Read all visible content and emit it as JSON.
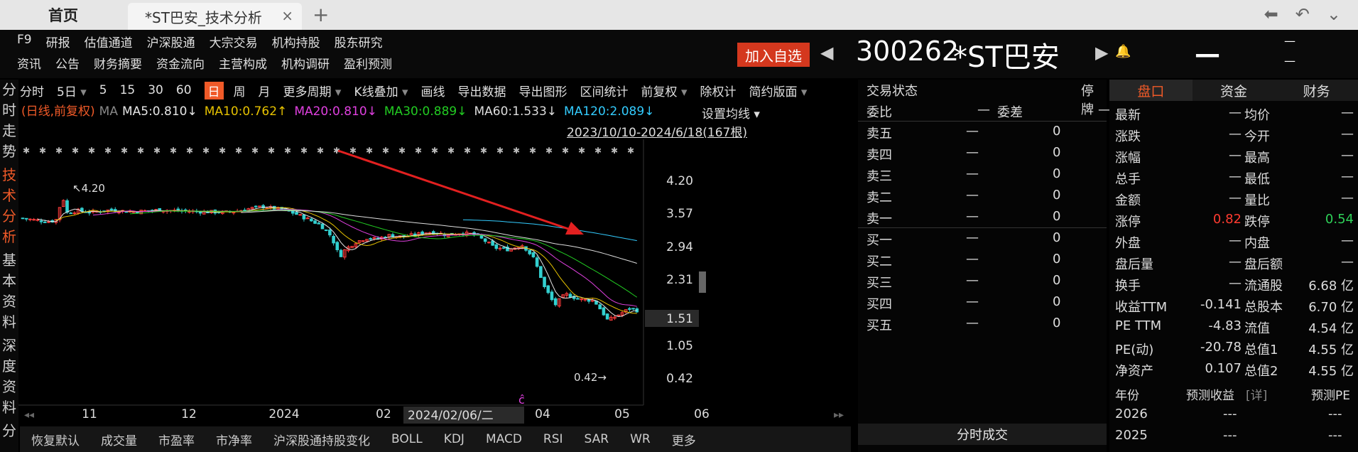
{
  "tabs": {
    "home": "首页",
    "active": "*ST巴安_技术分析",
    "close": "×",
    "add": "+"
  },
  "menu": {
    "row1": [
      "F9",
      "研报",
      "估值通道",
      "沪深股通",
      "大宗交易",
      "机构持股",
      "股东研究"
    ],
    "row2": [
      "资讯",
      "公告",
      "财务摘要",
      "资金流向",
      "主营构成",
      "机构调研",
      "盈利预测"
    ],
    "add_fav": "加入自选"
  },
  "stock": {
    "code": "300262",
    "name": "*ST巴安",
    "dash": "—"
  },
  "vnav": [
    {
      "label": "分时走势",
      "active": false
    },
    {
      "label": "技术分析",
      "active": true
    },
    {
      "label": "基本资料",
      "active": false
    },
    {
      "label": "深度资料",
      "active": false
    },
    {
      "label": "分",
      "active": false
    }
  ],
  "chart_toolbar": [
    "分时",
    "5日",
    "5",
    "15",
    "30",
    "60",
    "日",
    "周",
    "月",
    "更多周期",
    "K线叠加",
    "画线",
    "导出数据",
    "导出图形",
    "区间统计",
    "前复权",
    "除权计",
    "简约版面"
  ],
  "ma_legend": {
    "prefix": "(日线,前复权)",
    "ma": "MA",
    "items": [
      {
        "text": "MA5:0.810↓",
        "color": "#e6e6e6"
      },
      {
        "text": "MA10:0.762↑",
        "color": "#e6c200"
      },
      {
        "text": "MA20:0.810↓",
        "color": "#e040e0"
      },
      {
        "text": "MA30:0.889↓",
        "color": "#22cc22"
      },
      {
        "text": "MA60:1.533↓",
        "color": "#dddddd"
      },
      {
        "text": "MA120:2.089↓",
        "color": "#33ccff"
      }
    ]
  },
  "set_ma": "设置均线",
  "date_range": "2023/10/10-2024/6/18(167根)",
  "chart_data": {
    "type": "candlestick",
    "y_ticks": [
      "4.20",
      "3.57",
      "2.94",
      "2.31",
      "1.51",
      "1.05",
      "0.42"
    ],
    "y_log": true,
    "x_ticks": [
      "11",
      "12",
      "2024",
      "02",
      "04",
      "05",
      "06"
    ],
    "current_price_label": "1.51",
    "crosshair_date": "2024/02/06/二",
    "high_label": "4.20",
    "low_label": "0.42",
    "ylim": [
      0.42,
      4.2
    ]
  },
  "bottom_tabs": [
    "恢复默认",
    "成交量",
    "市盈率",
    "市净率",
    "沪深股通持股变化",
    "BOLL",
    "KDJ",
    "MACD",
    "RSI",
    "SAR",
    "WR",
    "更多"
  ],
  "orderbook": {
    "status_label": "交易状态",
    "status_value": "停牌",
    "wb_label": "委比",
    "wb_value": "—",
    "wc_label": "委差",
    "wc_value": "—",
    "sell": [
      [
        "卖五",
        "—",
        "0"
      ],
      [
        "卖四",
        "—",
        "0"
      ],
      [
        "卖三",
        "—",
        "0"
      ],
      [
        "卖二",
        "—",
        "0"
      ],
      [
        "卖一",
        "—",
        "0"
      ]
    ],
    "buy": [
      [
        "买一",
        "—",
        "0"
      ],
      [
        "买二",
        "—",
        "0"
      ],
      [
        "买三",
        "—",
        "0"
      ],
      [
        "买四",
        "—",
        "0"
      ],
      [
        "买五",
        "—",
        "0"
      ]
    ],
    "ticks_header": "分时成交"
  },
  "quote": {
    "tabs": [
      "盘口",
      "资金",
      "财务"
    ],
    "rows": [
      [
        "最新",
        "—",
        "均价",
        "—"
      ],
      [
        "涨跌",
        "—",
        "今开",
        "—"
      ],
      [
        "涨幅",
        "—",
        "最高",
        "—"
      ],
      [
        "总手",
        "—",
        "最低",
        "—"
      ],
      [
        "金额",
        "—",
        "量比",
        "—"
      ],
      [
        "涨停",
        "0.82",
        "跌停",
        "0.54"
      ],
      [
        "外盘",
        "—",
        "内盘",
        "—"
      ],
      [
        "盘后量",
        "—",
        "盘后额",
        "—"
      ],
      [
        "换手",
        "—",
        "流通股",
        "6.68 亿"
      ],
      [
        "收益TTM",
        "-0.141",
        "总股本",
        "6.70 亿"
      ],
      [
        "PE TTM",
        "-4.83",
        "流值",
        "4.54 亿"
      ],
      [
        "PE(动)",
        "-20.78",
        "总值1",
        "4.55 亿"
      ],
      [
        "净资产",
        "0.107",
        "总值2",
        "4.55 亿"
      ]
    ],
    "forecast_header": [
      "年份",
      "预测收益",
      "[详]",
      "预测PE"
    ],
    "forecast": [
      [
        "2026",
        "---",
        "---"
      ],
      [
        "2025",
        "---",
        "---"
      ]
    ]
  }
}
